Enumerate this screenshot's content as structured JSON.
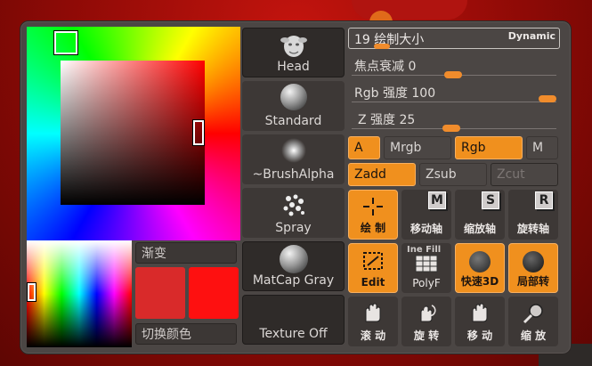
{
  "color_picker": {
    "gradient_label": "渐变",
    "switch_color_label": "切换颜色",
    "main_color": "#d92a2a",
    "secondary_color": "#fe1010"
  },
  "brush_column": {
    "brush": "Head",
    "stroke": "Standard",
    "alpha": "~BrushAlpha",
    "spray": "Spray",
    "material": "MatCap Gray",
    "texture": "Texture Off"
  },
  "sliders": {
    "draw_size_label": "19  绘制大小",
    "dynamic_label": "Dynamic",
    "focal_shift": "焦点衰减 0",
    "rgb_intensity": "Rgb 强度 100",
    "z_intensity": "Z 强度 25"
  },
  "toggles": {
    "a": "A",
    "mrgb": "Mrgb",
    "rgb": "Rgb",
    "m": "M",
    "zadd": "Zadd",
    "zsub": "Zsub",
    "zcut": "Zcut"
  },
  "actions": {
    "draw": "绘 制",
    "move": "移动轴",
    "scale": "缩放轴",
    "rotate": "旋转轴",
    "edit": "Edit",
    "polyf": "PolyF",
    "line_fill": "Ine Fill",
    "quick3d": "快速3D",
    "local_rotate": "局部转",
    "scroll": "滚 动",
    "rotate2": "旋 转",
    "move2": "移 动",
    "zoom": "缩 放"
  },
  "colors": {
    "accent": "#f0901e",
    "panel": "#4b4644"
  }
}
